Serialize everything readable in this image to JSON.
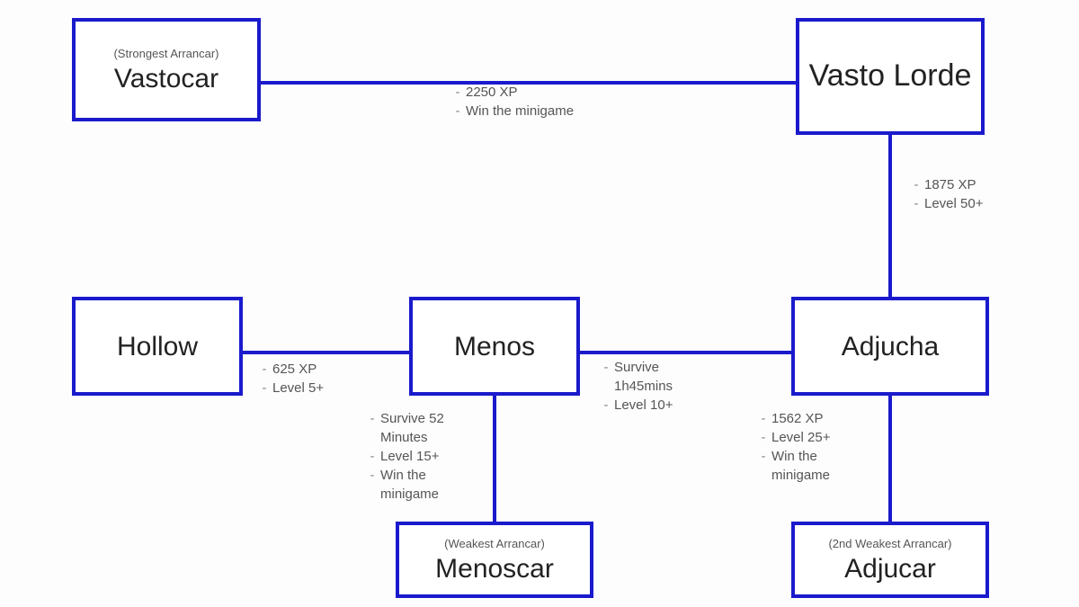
{
  "nodes": {
    "vastocar": {
      "subtitle": "(Strongest Arrancar)",
      "title": "Vastocar"
    },
    "vastolorde": {
      "subtitle": "",
      "title": "Vasto Lorde"
    },
    "hollow": {
      "subtitle": "",
      "title": "Hollow"
    },
    "menos": {
      "subtitle": "",
      "title": "Menos"
    },
    "adjucha": {
      "subtitle": "",
      "title": "Adjucha"
    },
    "menoscar": {
      "subtitle": "(Weakest Arrancar)",
      "title": "Menoscar"
    },
    "adjucar": {
      "subtitle": "(2nd Weakest Arrancar)",
      "title": "Adjucar"
    }
  },
  "reqs": {
    "vastocar_vl": {
      "i0": "2250 XP",
      "i1": "Win the minigame"
    },
    "vl_adjucha": {
      "i0": "1875 XP",
      "i1": "Level 50+"
    },
    "hollow_menos": {
      "i0": "625 XP",
      "i1": "Level 5+"
    },
    "menos_adjucha": {
      "i0": "Survive 1h45mins",
      "i1": "Level 10+"
    },
    "menos_menoscar": {
      "i0": "Survive 52 Minutes",
      "i1": "Level 15+",
      "i2": "Win the minigame"
    },
    "adjucha_adjucar": {
      "i0": "1562 XP",
      "i1": "Level 25+",
      "i2": "Win the minigame"
    }
  }
}
